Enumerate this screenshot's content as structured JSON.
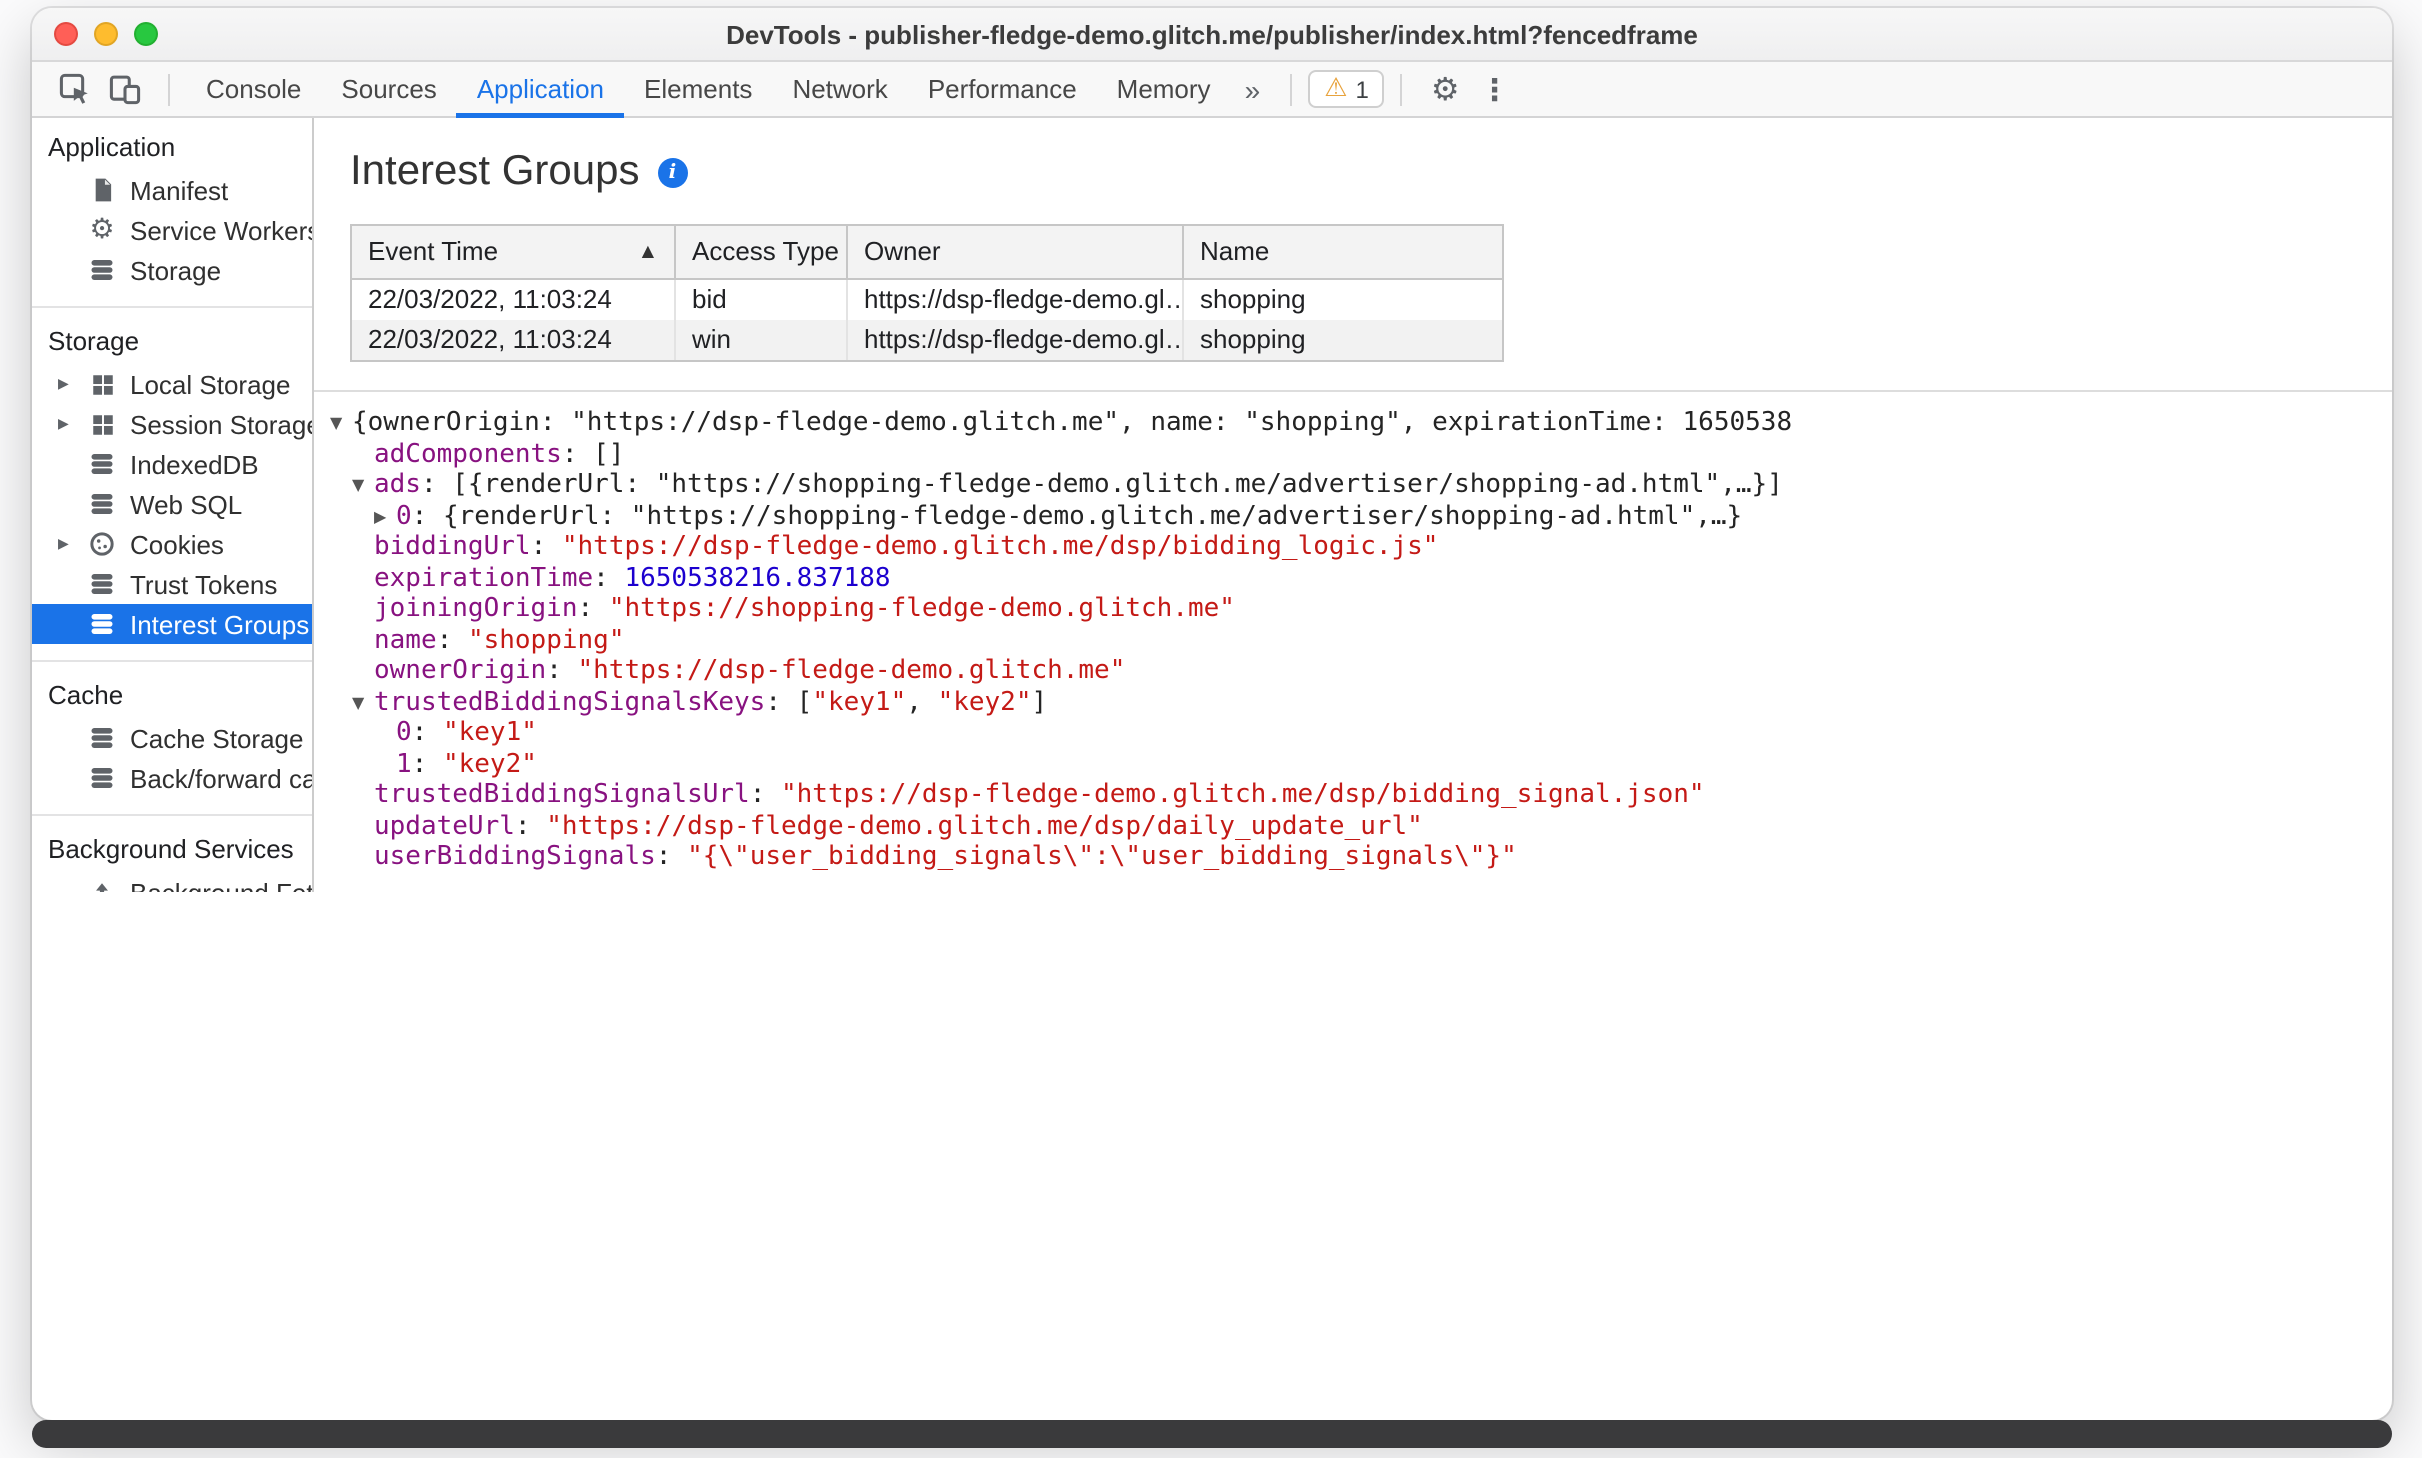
{
  "window": {
    "title": "DevTools - publisher-fledge-demo.glitch.me/publisher/index.html?fencedframe"
  },
  "toolbar": {
    "tabs": [
      {
        "label": "Console"
      },
      {
        "label": "Sources"
      },
      {
        "label": "Application"
      },
      {
        "label": "Elements"
      },
      {
        "label": "Network"
      },
      {
        "label": "Performance"
      },
      {
        "label": "Memory"
      }
    ],
    "active_tab": "Application",
    "more_tabs_label": "»",
    "warning_count": "1"
  },
  "sidebar": {
    "sections": [
      {
        "title": "Application",
        "items": [
          {
            "label": "Manifest",
            "icon": "document-icon"
          },
          {
            "label": "Service Workers",
            "icon": "gear-icon"
          },
          {
            "label": "Storage",
            "icon": "database-icon"
          }
        ]
      },
      {
        "title": "Storage",
        "items": [
          {
            "label": "Local Storage",
            "icon": "table-icon",
            "expandable": true
          },
          {
            "label": "Session Storage",
            "icon": "table-icon",
            "expandable": true
          },
          {
            "label": "IndexedDB",
            "icon": "database-icon"
          },
          {
            "label": "Web SQL",
            "icon": "database-icon"
          },
          {
            "label": "Cookies",
            "icon": "cookie-icon",
            "expandable": true
          },
          {
            "label": "Trust Tokens",
            "icon": "database-icon"
          },
          {
            "label": "Interest Groups",
            "icon": "database-icon",
            "selected": true
          }
        ]
      },
      {
        "title": "Cache",
        "items": [
          {
            "label": "Cache Storage",
            "icon": "database-icon"
          },
          {
            "label": "Back/forward cach",
            "icon": "database-icon"
          }
        ]
      },
      {
        "title": "Background Services",
        "items": [
          {
            "label": "Background Fetch",
            "icon": "updown-arrow-icon"
          }
        ]
      }
    ]
  },
  "main": {
    "title": "Interest Groups",
    "table": {
      "columns": [
        "Event Time",
        "Access Type",
        "Owner",
        "Name"
      ],
      "sort_column": "Event Time",
      "sort_direction": "ascending",
      "rows": [
        [
          "22/03/2022, 11:03:24",
          "bid",
          "https://dsp-fledge-demo.gl…",
          "shopping"
        ],
        [
          "22/03/2022, 11:03:24",
          "win",
          "https://dsp-fledge-demo.gl…",
          "shopping"
        ]
      ]
    },
    "tree": {
      "lines": [
        {
          "level": 0,
          "arrow": "down",
          "segments": [
            {
              "t": "{ownerOrigin: \"https://dsp-fledge-demo.glitch.me\", name: \"shopping\", expirationTime: 1650538",
              "c": "plain"
            }
          ]
        },
        {
          "level": 1,
          "segments": [
            {
              "t": "adComponents",
              "c": "key"
            },
            {
              "t": ": []",
              "c": "plain"
            }
          ]
        },
        {
          "level": 1,
          "arrow": "down",
          "segments": [
            {
              "t": "ads",
              "c": "key"
            },
            {
              "t": ": [{renderUrl: \"https://shopping-fledge-demo.glitch.me/advertiser/shopping-ad.html\",…}]",
              "c": "plain"
            }
          ]
        },
        {
          "level": 2,
          "arrow": "right",
          "segments": [
            {
              "t": "0",
              "c": "key"
            },
            {
              "t": ": {renderUrl: \"https://shopping-fledge-demo.glitch.me/advertiser/shopping-ad.html\",…}",
              "c": "plain"
            }
          ]
        },
        {
          "level": 1,
          "segments": [
            {
              "t": "biddingUrl",
              "c": "key"
            },
            {
              "t": ": ",
              "c": "plain"
            },
            {
              "t": "\"https://dsp-fledge-demo.glitch.me/dsp/bidding_logic.js\"",
              "c": "string"
            }
          ]
        },
        {
          "level": 1,
          "segments": [
            {
              "t": "expirationTime",
              "c": "key"
            },
            {
              "t": ": ",
              "c": "plain"
            },
            {
              "t": "1650538216.837188",
              "c": "number"
            }
          ]
        },
        {
          "level": 1,
          "segments": [
            {
              "t": "joiningOrigin",
              "c": "key"
            },
            {
              "t": ": ",
              "c": "plain"
            },
            {
              "t": "\"https://shopping-fledge-demo.glitch.me\"",
              "c": "string"
            }
          ]
        },
        {
          "level": 1,
          "segments": [
            {
              "t": "name",
              "c": "key"
            },
            {
              "t": ": ",
              "c": "plain"
            },
            {
              "t": "\"shopping\"",
              "c": "string"
            }
          ]
        },
        {
          "level": 1,
          "segments": [
            {
              "t": "ownerOrigin",
              "c": "key"
            },
            {
              "t": ": ",
              "c": "plain"
            },
            {
              "t": "\"https://dsp-fledge-demo.glitch.me\"",
              "c": "string"
            }
          ]
        },
        {
          "level": 1,
          "arrow": "down",
          "segments": [
            {
              "t": "trustedBiddingSignalsKeys",
              "c": "key"
            },
            {
              "t": ": [",
              "c": "plain"
            },
            {
              "t": "\"key1\"",
              "c": "string"
            },
            {
              "t": ", ",
              "c": "plain"
            },
            {
              "t": "\"key2\"",
              "c": "string"
            },
            {
              "t": "]",
              "c": "plain"
            }
          ]
        },
        {
          "level": 2,
          "segments": [
            {
              "t": "0",
              "c": "key"
            },
            {
              "t": ": ",
              "c": "plain"
            },
            {
              "t": "\"key1\"",
              "c": "string"
            }
          ]
        },
        {
          "level": 2,
          "segments": [
            {
              "t": "1",
              "c": "key"
            },
            {
              "t": ": ",
              "c": "plain"
            },
            {
              "t": "\"key2\"",
              "c": "string"
            }
          ]
        },
        {
          "level": 1,
          "segments": [
            {
              "t": "trustedBiddingSignalsUrl",
              "c": "key"
            },
            {
              "t": ": ",
              "c": "plain"
            },
            {
              "t": "\"https://dsp-fledge-demo.glitch.me/dsp/bidding_signal.json\"",
              "c": "string"
            }
          ]
        },
        {
          "level": 1,
          "segments": [
            {
              "t": "updateUrl",
              "c": "key"
            },
            {
              "t": ": ",
              "c": "plain"
            },
            {
              "t": "\"https://dsp-fledge-demo.glitch.me/dsp/daily_update_url\"",
              "c": "string"
            }
          ]
        },
        {
          "level": 1,
          "segments": [
            {
              "t": "userBiddingSignals",
              "c": "key"
            },
            {
              "t": ": ",
              "c": "plain"
            },
            {
              "t": "\"{\\\"user_bidding_signals\\\":\\\"user_bidding_signals\\\"}\"",
              "c": "string"
            }
          ]
        }
      ]
    }
  },
  "colors": {
    "accent_blue": "#1a73e8",
    "selected_item_bg": "#1a73e8",
    "syntax_key_purple": "#881280",
    "syntax_string_red": "#c41a16",
    "syntax_number_blue": "#1c00cf",
    "warning_yellow": "#e8a33d"
  }
}
